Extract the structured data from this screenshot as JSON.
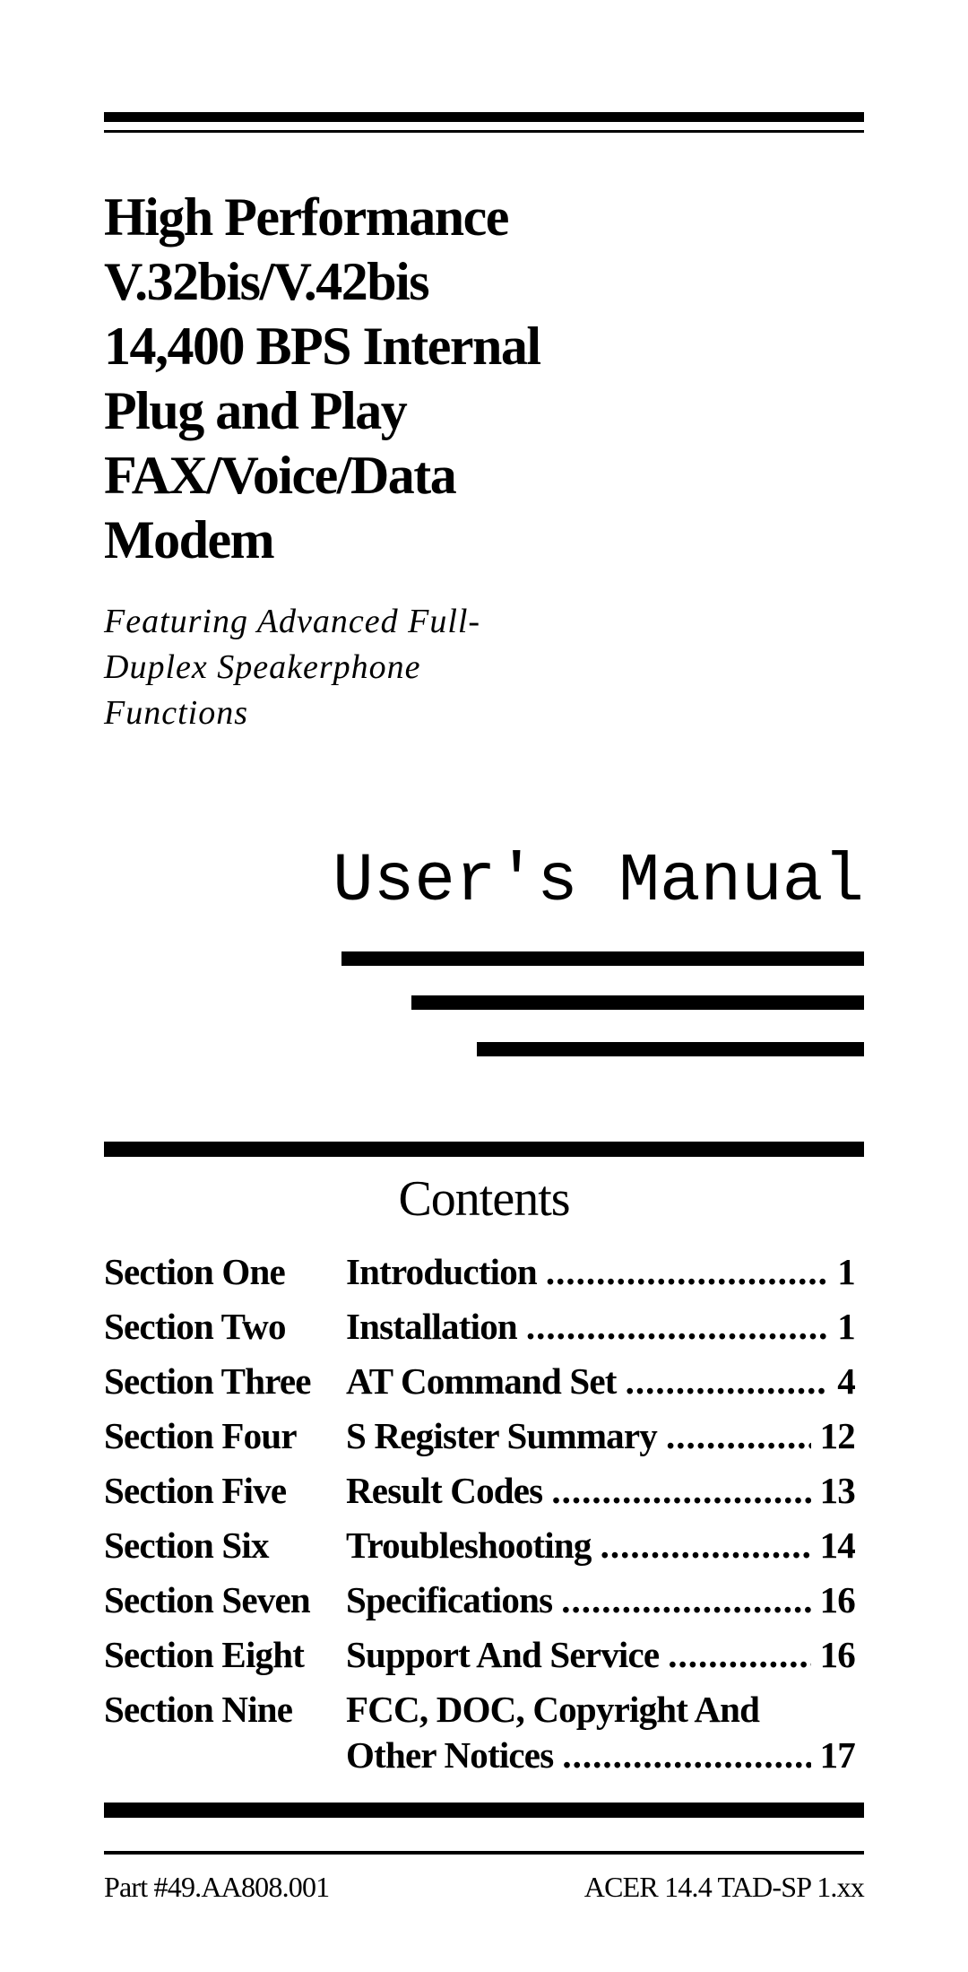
{
  "title_lines": [
    "High Performance",
    "V.32bis/V.42bis",
    "14,400 BPS Internal",
    "Plug and Play",
    "FAX/Voice/Data",
    "Modem"
  ],
  "subtitle_lines": [
    "Featuring Advanced Full-",
    "Duplex Speakerphone",
    "Functions"
  ],
  "manual_title": "User's Manual",
  "contents": {
    "heading": "Contents",
    "entries": [
      {
        "section": "Section One",
        "title": "Introduction",
        "page": "1"
      },
      {
        "section": "Section Two",
        "title": "Installation",
        "page": "1"
      },
      {
        "section": "Section Three",
        "title": "AT Command Set",
        "page": "4"
      },
      {
        "section": "Section Four",
        "title": "S Register Summary",
        "page": "12"
      },
      {
        "section": "Section Five",
        "title": "Result Codes",
        "page": "13"
      },
      {
        "section": "Section Six",
        "title": "Troubleshooting",
        "page": "14"
      },
      {
        "section": "Section Seven",
        "title": "Specifications",
        "page": "16"
      },
      {
        "section": "Section Eight",
        "title": "Support And Service",
        "page": "16"
      },
      {
        "section": "Section Nine",
        "title_line1": "FCC, DOC, Copyright And",
        "title": "Other Notices",
        "page": "17"
      }
    ]
  },
  "footer": {
    "part_number": "Part #49.AA808.001",
    "model": "ACER 14.4 TAD-SP 1.xx"
  }
}
